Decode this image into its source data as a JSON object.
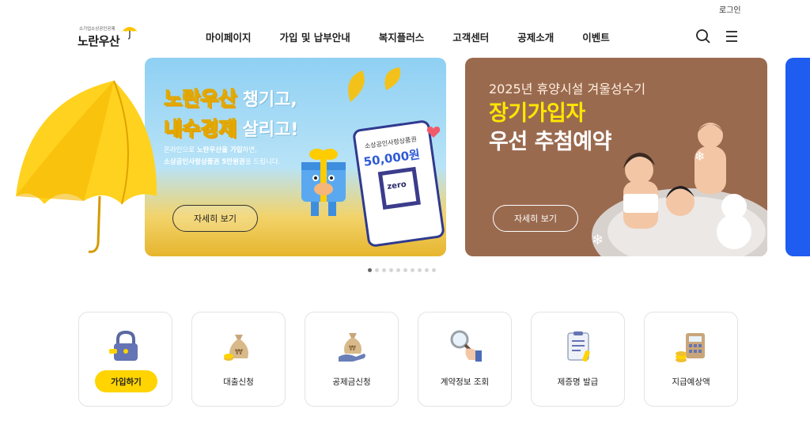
{
  "header": {
    "login_label": "로그인",
    "logo_sub": "소기업소상공인공제",
    "logo_main": "노란우산",
    "nav": [
      "마이페이지",
      "가입 및 납부안내",
      "복지플러스",
      "고객센터",
      "공제소개",
      "이벤트"
    ]
  },
  "banners": [
    {
      "title1_highlight": "노란우산",
      "title1_rest": " 챙기고,",
      "title2_highlight": "내수경제",
      "title2_rest": " 살리고!",
      "desc_line1_pre": "온라인으로 ",
      "desc_line1_bold": "노란우산을 가입",
      "desc_line1_post": "하면,",
      "desc_line2_bold": "소상공인사랑상품권 5만원권",
      "desc_line2_post": "을 드립니다.",
      "coupon_label": "소상공인사랑상품권",
      "coupon_amount": "50,000원",
      "coupon_qr_text": "zero",
      "button_label": "자세히 보기"
    },
    {
      "subtitle": "2025년 휴양시설 겨울성수기",
      "title_line1": "장기가입자",
      "title_line2": "우선 추첨예약",
      "button_label": "자세히 보기"
    }
  ],
  "slider": {
    "total_slides": 10,
    "active_index": 0
  },
  "quick_menu": [
    {
      "label": "가입하기",
      "icon": "lock-icon",
      "primary": true
    },
    {
      "label": "대출신청",
      "icon": "money-bag-icon",
      "primary": false
    },
    {
      "label": "공제금신청",
      "icon": "money-bag-hand-icon",
      "primary": false
    },
    {
      "label": "계약정보 조회",
      "icon": "magnifier-hand-icon",
      "primary": false
    },
    {
      "label": "제증명 발급",
      "icon": "clipboard-icon",
      "primary": false
    },
    {
      "label": "지급예상액",
      "icon": "calculator-icon",
      "primary": false
    }
  ],
  "colors": {
    "brand_yellow": "#ffd400",
    "banner2_bg": "#9a6a4f",
    "banner3_bg": "#1f5cf0"
  }
}
